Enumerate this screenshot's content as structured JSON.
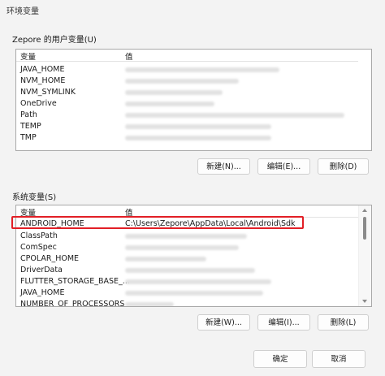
{
  "window": {
    "title": "环境变量"
  },
  "user_vars": {
    "label": "Zepore 的用户变量(U)",
    "col_var": "变量",
    "col_value": "值",
    "rows": [
      {
        "name": "JAVA_HOME"
      },
      {
        "name": "NVM_HOME"
      },
      {
        "name": "NVM_SYMLINK"
      },
      {
        "name": "OneDrive"
      },
      {
        "name": "Path"
      },
      {
        "name": "TEMP"
      },
      {
        "name": "TMP"
      }
    ],
    "buttons": {
      "new": "新建(N)...",
      "edit": "编辑(E)...",
      "delete": "删除(D)"
    }
  },
  "system_vars": {
    "label": "系统变量(S)",
    "col_var": "变量",
    "col_value": "值",
    "rows": [
      {
        "name": "ANDROID_HOME",
        "value": "C:\\Users\\Zepore\\AppData\\Local\\Android\\Sdk"
      },
      {
        "name": "ClassPath"
      },
      {
        "name": "ComSpec"
      },
      {
        "name": "CPOLAR_HOME"
      },
      {
        "name": "DriverData"
      },
      {
        "name": "FLUTTER_STORAGE_BASE_..."
      },
      {
        "name": "JAVA_HOME"
      },
      {
        "name": "NUMBER_OF_PROCESSORS"
      }
    ],
    "buttons": {
      "new": "新建(W)...",
      "edit": "编辑(I)...",
      "delete": "删除(L)"
    }
  },
  "footer": {
    "ok": "确定",
    "cancel": "取消"
  },
  "colors": {
    "highlight_border": "#e21f26",
    "window_bg": "#f3f3f3"
  }
}
